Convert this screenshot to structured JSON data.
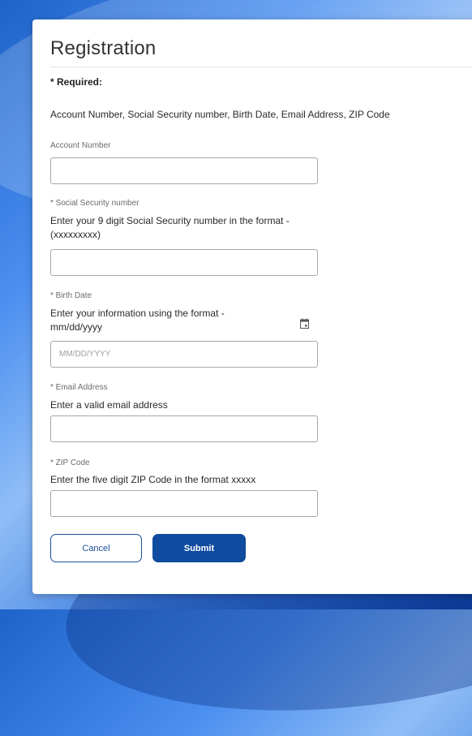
{
  "form": {
    "title": "Registration",
    "required_heading": "* Required:",
    "required_list": "Account Number, Social Security number, Birth Date, Email Address, ZIP Code",
    "fields": {
      "account_number": {
        "label": "Account Number",
        "value": ""
      },
      "ssn": {
        "label": "* Social Security number",
        "description": "Enter your 9 digit Social Security number in the format - (xxxxxxxxx)",
        "value": ""
      },
      "birth_date": {
        "label": "* Birth Date",
        "description": "Enter your information using the format - mm/dd/yyyy",
        "placeholder": "MM/DD/YYYY",
        "value": "",
        "icon": "calendar-icon"
      },
      "email": {
        "label": "* Email Address",
        "description": "Enter a valid email address",
        "value": ""
      },
      "zip": {
        "label": "* ZIP Code",
        "description": "Enter the five digit ZIP Code in the format xxxxx",
        "value": ""
      }
    },
    "buttons": {
      "cancel_label": "Cancel",
      "submit_label": "Submit"
    }
  },
  "colors": {
    "primary": "#0f4b9e",
    "outline": "#1d4f9a",
    "input_border": "#a8a8a8",
    "background_gradient_start": "#1e63c9",
    "background_gradient_end": "#0d3f9f"
  }
}
